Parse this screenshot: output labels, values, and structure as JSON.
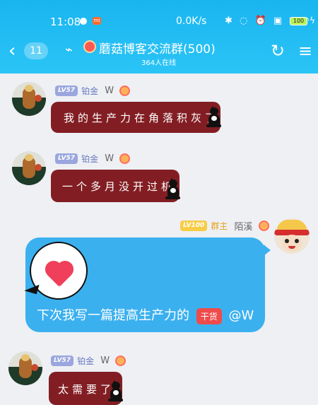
{
  "status": {
    "time": "11:08",
    "network": "0.0K/s",
    "battery": "100",
    "icons": [
      "bluetooth-icon",
      "mute-icon",
      "alarm-icon",
      "hd-icon",
      "signal-icon",
      "wifi-icon"
    ]
  },
  "header": {
    "back_count": "11",
    "title": "蘑菇博客交流群(500)",
    "online": "364人在线"
  },
  "messages": [
    {
      "sender": "W",
      "level": "LV57",
      "rank": "铂金",
      "text": "我的生产力在角落积灰了"
    },
    {
      "sender": "W",
      "level": "LV57",
      "rank": "铂金",
      "text": "一个多月没开过机"
    },
    {
      "sender": "陌溪",
      "level": "LV100",
      "rank": "群主",
      "text_before": "下次我写一篇提高生产力的",
      "tag": "干货",
      "text_after": "@W"
    },
    {
      "sender": "W",
      "level": "LV57",
      "rank": "铂金",
      "text": "太需要了"
    }
  ],
  "colors": {
    "header": "#19b5f0",
    "dark_bubble": "#821e23",
    "blue_bubble": "#3bb0ef",
    "badge_purple": "#9aa6dd",
    "badge_gold": "#f7cd46"
  }
}
